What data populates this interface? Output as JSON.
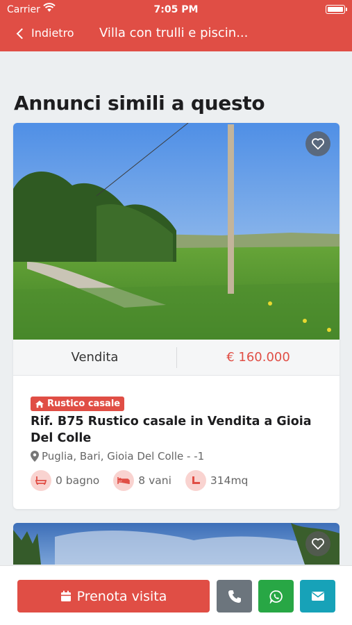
{
  "status_bar": {
    "carrier": "Carrier",
    "time": "7:05 PM"
  },
  "nav": {
    "back_label": "Indietro",
    "title": "Villa con trulli e piscin..."
  },
  "section": {
    "title": "Annunci simili a questo"
  },
  "listing": {
    "mode": "Vendita",
    "price": "€ 160.000",
    "category": "Rustico casale",
    "title": "Rif. B75 Rustico casale in Vendita a Gioia Del Colle",
    "location": "Puglia, Bari, Gioia Del Colle - -1",
    "bathrooms": "0 bagno",
    "rooms": "8 vani",
    "area": "314mq"
  },
  "actions": {
    "book_label": "Prenota visita"
  },
  "colors": {
    "accent": "#e04e45",
    "phone": "#6c757d",
    "whatsapp": "#28a745",
    "mail": "#17a2b8"
  }
}
